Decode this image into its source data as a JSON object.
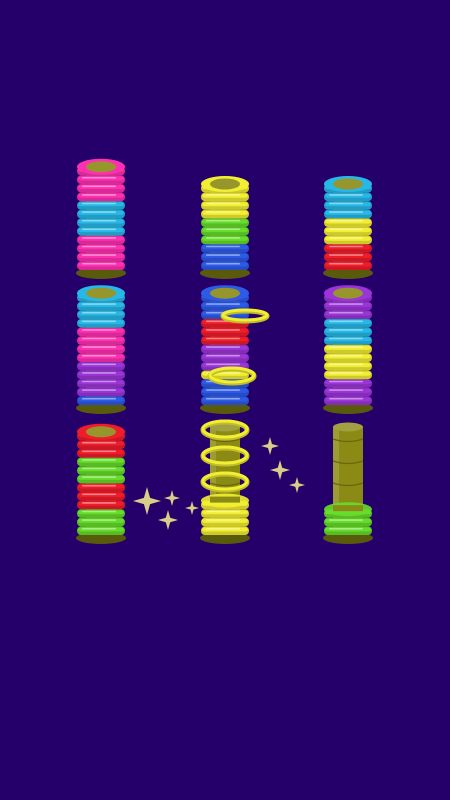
{
  "game": {
    "background": "#25006b",
    "peg_color": "#8a8a14",
    "colors": {
      "pink": "#ff2fb2",
      "cyan": "#27b8e8",
      "yellow": "#f2ee32",
      "green": "#66dd2a",
      "blue": "#2d5be8",
      "red": "#f01c2a",
      "purple": "#9b35d8"
    },
    "pegs": [
      {
        "name": "peg-1",
        "rings_bottom_to_top": [
          "pink",
          "pink",
          "pink",
          "pink",
          "cyan",
          "cyan",
          "cyan",
          "cyan",
          "pink",
          "pink",
          "pink",
          "pink"
        ]
      },
      {
        "name": "peg-2",
        "rings_bottom_to_top": [
          "blue",
          "blue",
          "blue",
          "green",
          "green",
          "green",
          "yellow",
          "yellow",
          "yellow",
          "yellow"
        ]
      },
      {
        "name": "peg-3",
        "rings_bottom_to_top": [
          "red",
          "red",
          "red",
          "yellow",
          "yellow",
          "yellow",
          "cyan",
          "cyan",
          "cyan",
          "cyan"
        ]
      },
      {
        "name": "peg-4",
        "rings_bottom_to_top": [
          "blue",
          "purple",
          "purple",
          "purple",
          "purple",
          "pink",
          "pink",
          "pink",
          "pink",
          "cyan",
          "cyan",
          "cyan",
          "cyan"
        ]
      },
      {
        "name": "peg-5",
        "rings_bottom_to_top": [
          "blue",
          "blue",
          "blue",
          "yellow",
          "purple",
          "purple",
          "purple",
          "red",
          "red",
          "red",
          "blue",
          "blue",
          "blue"
        ]
      },
      {
        "name": "peg-6",
        "rings_bottom_to_top": [
          "purple",
          "purple",
          "purple",
          "yellow",
          "yellow",
          "yellow",
          "yellow",
          "cyan",
          "cyan",
          "cyan",
          "purple",
          "purple",
          "purple"
        ]
      },
      {
        "name": "peg-7",
        "rings_bottom_to_top": [
          "green",
          "green",
          "green",
          "red",
          "red",
          "red",
          "green",
          "green",
          "green",
          "red",
          "red",
          "red"
        ]
      },
      {
        "name": "peg-8",
        "rings_bottom_to_top": [
          "yellow",
          "yellow",
          "yellow",
          "yellow"
        ]
      },
      {
        "name": "peg-9",
        "rings_bottom_to_top": [
          "green",
          "green",
          "green"
        ]
      }
    ],
    "moving_rings": [
      {
        "name": "moving-ring-1",
        "color": "yellow"
      },
      {
        "name": "moving-ring-2",
        "color": "yellow"
      },
      {
        "name": "moving-ring-3",
        "color": "yellow"
      },
      {
        "name": "moving-ring-4",
        "color": "yellow"
      },
      {
        "name": "moving-ring-5",
        "color": "yellow"
      }
    ],
    "sparkle_color": "#e8df8a"
  }
}
